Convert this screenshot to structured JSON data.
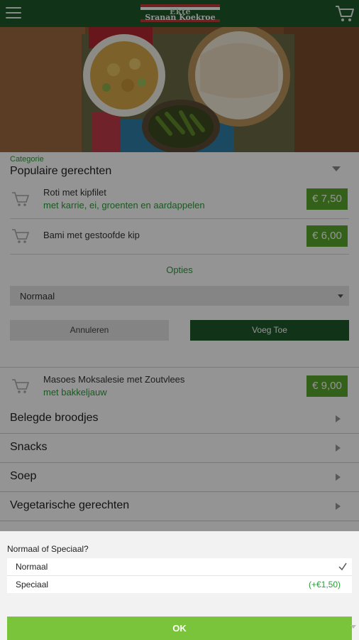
{
  "header": {
    "logo_line1": "Ekte",
    "logo_line2": "Sranan Koekroe",
    "colors": {
      "bar": "#1e5a2c"
    },
    "menu_icon": "hamburger-icon",
    "cart_icon": "cart-icon"
  },
  "category": {
    "label": "Categorie",
    "value": "Populaire gerechten"
  },
  "items": [
    {
      "name": "Roti met kipfilet",
      "sub": "met karrie, ei, groenten en aardappelen",
      "price": "€ 7,50"
    },
    {
      "name": "Bami met gestoofde kip",
      "sub": "",
      "price": "€ 6,00"
    },
    {
      "name": "Masoes Moksalesie met Zoutvlees",
      "sub": "met bakkeljauw",
      "price": "€ 9,00"
    }
  ],
  "options_panel": {
    "title": "Opties",
    "selected": "Normaal",
    "cancel_label": "Annuleren",
    "add_label": "Voeg Toe"
  },
  "categories": [
    "Belegde broodjes",
    "Snacks",
    "Soep",
    "Vegetarische gerechten"
  ],
  "sheet": {
    "question": "Normaal of Speciaal?",
    "options": [
      {
        "label": "Normaal",
        "extra": "",
        "selected": true
      },
      {
        "label": "Speciaal",
        "extra": "(+€1,50)",
        "selected": false
      }
    ],
    "ok_label": "OK",
    "accent": "#79c43a"
  },
  "colors": {
    "green_text": "#2f9a3c",
    "price_bg": "#5aa82c"
  }
}
